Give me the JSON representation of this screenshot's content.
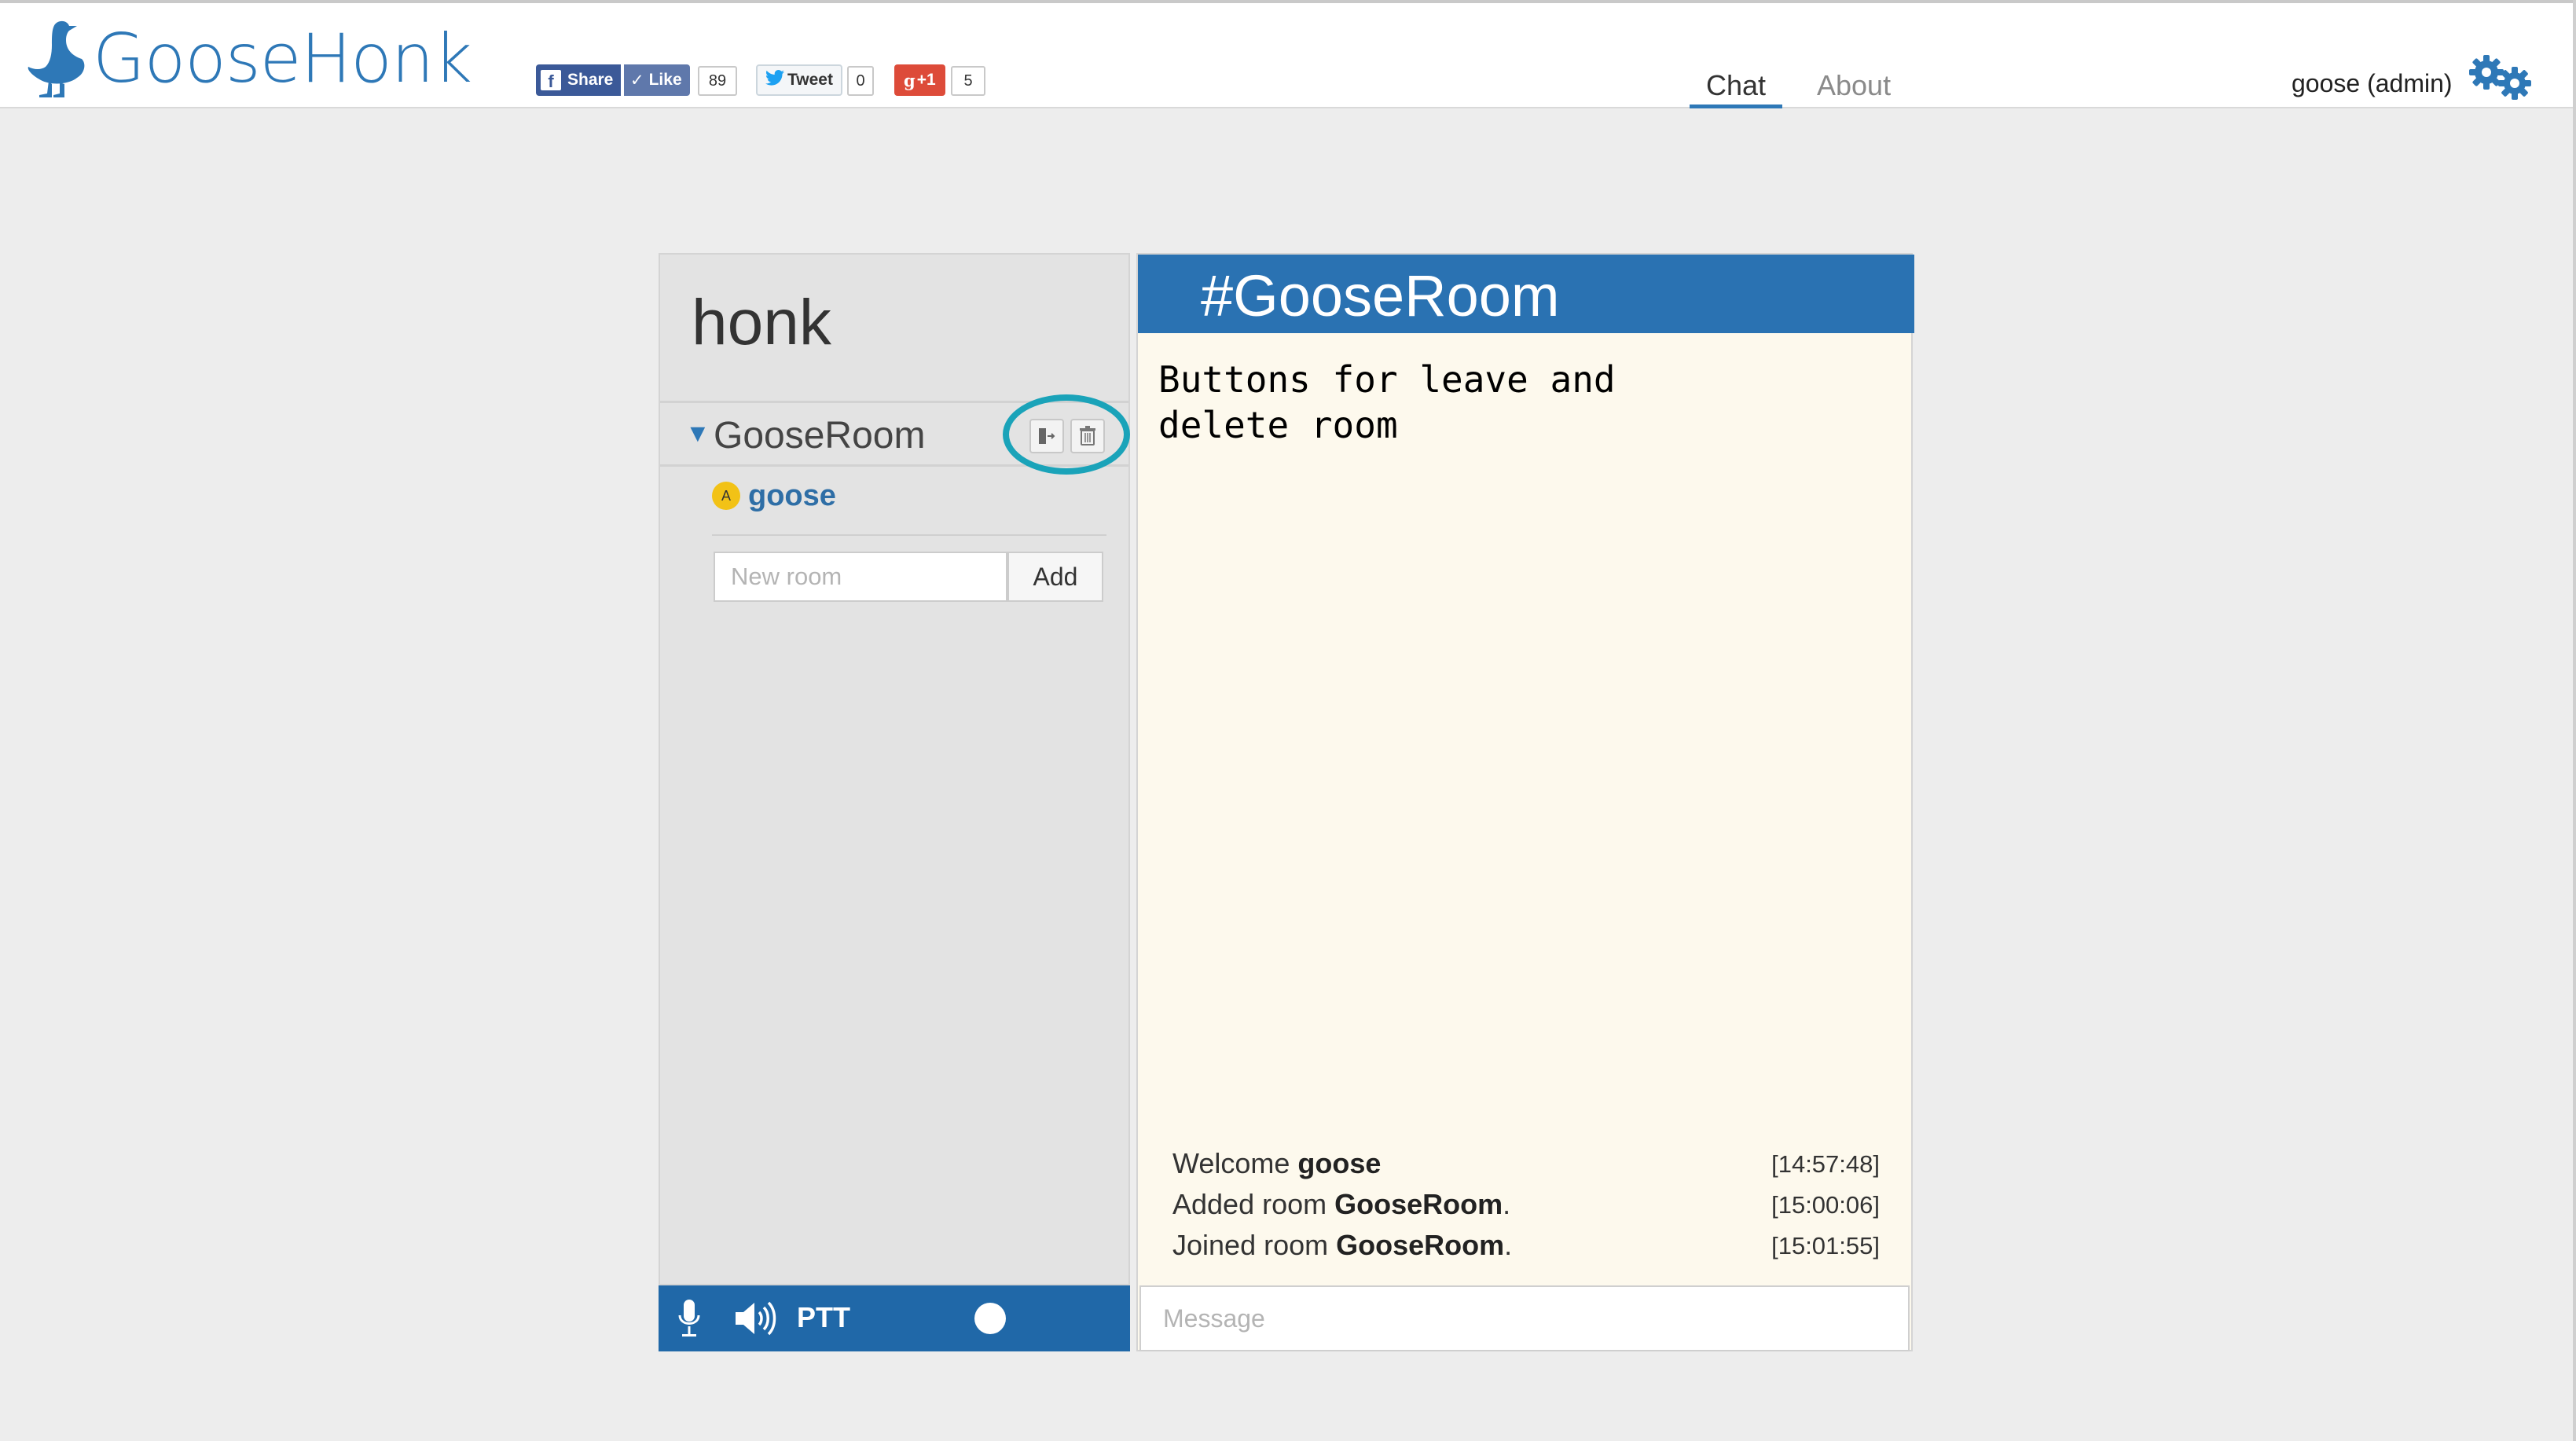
{
  "header": {
    "logo_text": "GooseHonk",
    "social": {
      "fb_share": "Share",
      "fb_like": "Like",
      "fb_count": "89",
      "tweet": "Tweet",
      "tweet_count": "0",
      "gplus": "+1",
      "gplus_count": "5"
    },
    "nav": {
      "chat": "Chat",
      "about": "About",
      "active": "chat"
    },
    "user_label": "goose (admin)",
    "accent_color": "#2e78b7"
  },
  "sidebar": {
    "server_name": "honk",
    "rooms": [
      {
        "name": "GooseRoom",
        "expanded": true,
        "users": [
          {
            "badge": "A",
            "name": "goose"
          }
        ]
      }
    ],
    "new_room_placeholder": "New room",
    "add_button": "Add"
  },
  "audio": {
    "ptt_label": "PTT"
  },
  "chat": {
    "room_title": "#GooseRoom",
    "annotation": "Buttons for leave and delete room",
    "messages": [
      {
        "prefix": "Welcome ",
        "bold": "goose",
        "suffix": "",
        "time": "[14:57:48]"
      },
      {
        "prefix": "Added room ",
        "bold": "GooseRoom",
        "suffix": ".",
        "time": "[15:00:06]"
      },
      {
        "prefix": "Joined room ",
        "bold": "GooseRoom",
        "suffix": ".",
        "time": "[15:01:55]"
      }
    ],
    "message_placeholder": "Message"
  },
  "colors": {
    "header_blue": "#2a72b2",
    "highlight_ring": "#1aa3b9",
    "admin_badge": "#f2c216"
  }
}
